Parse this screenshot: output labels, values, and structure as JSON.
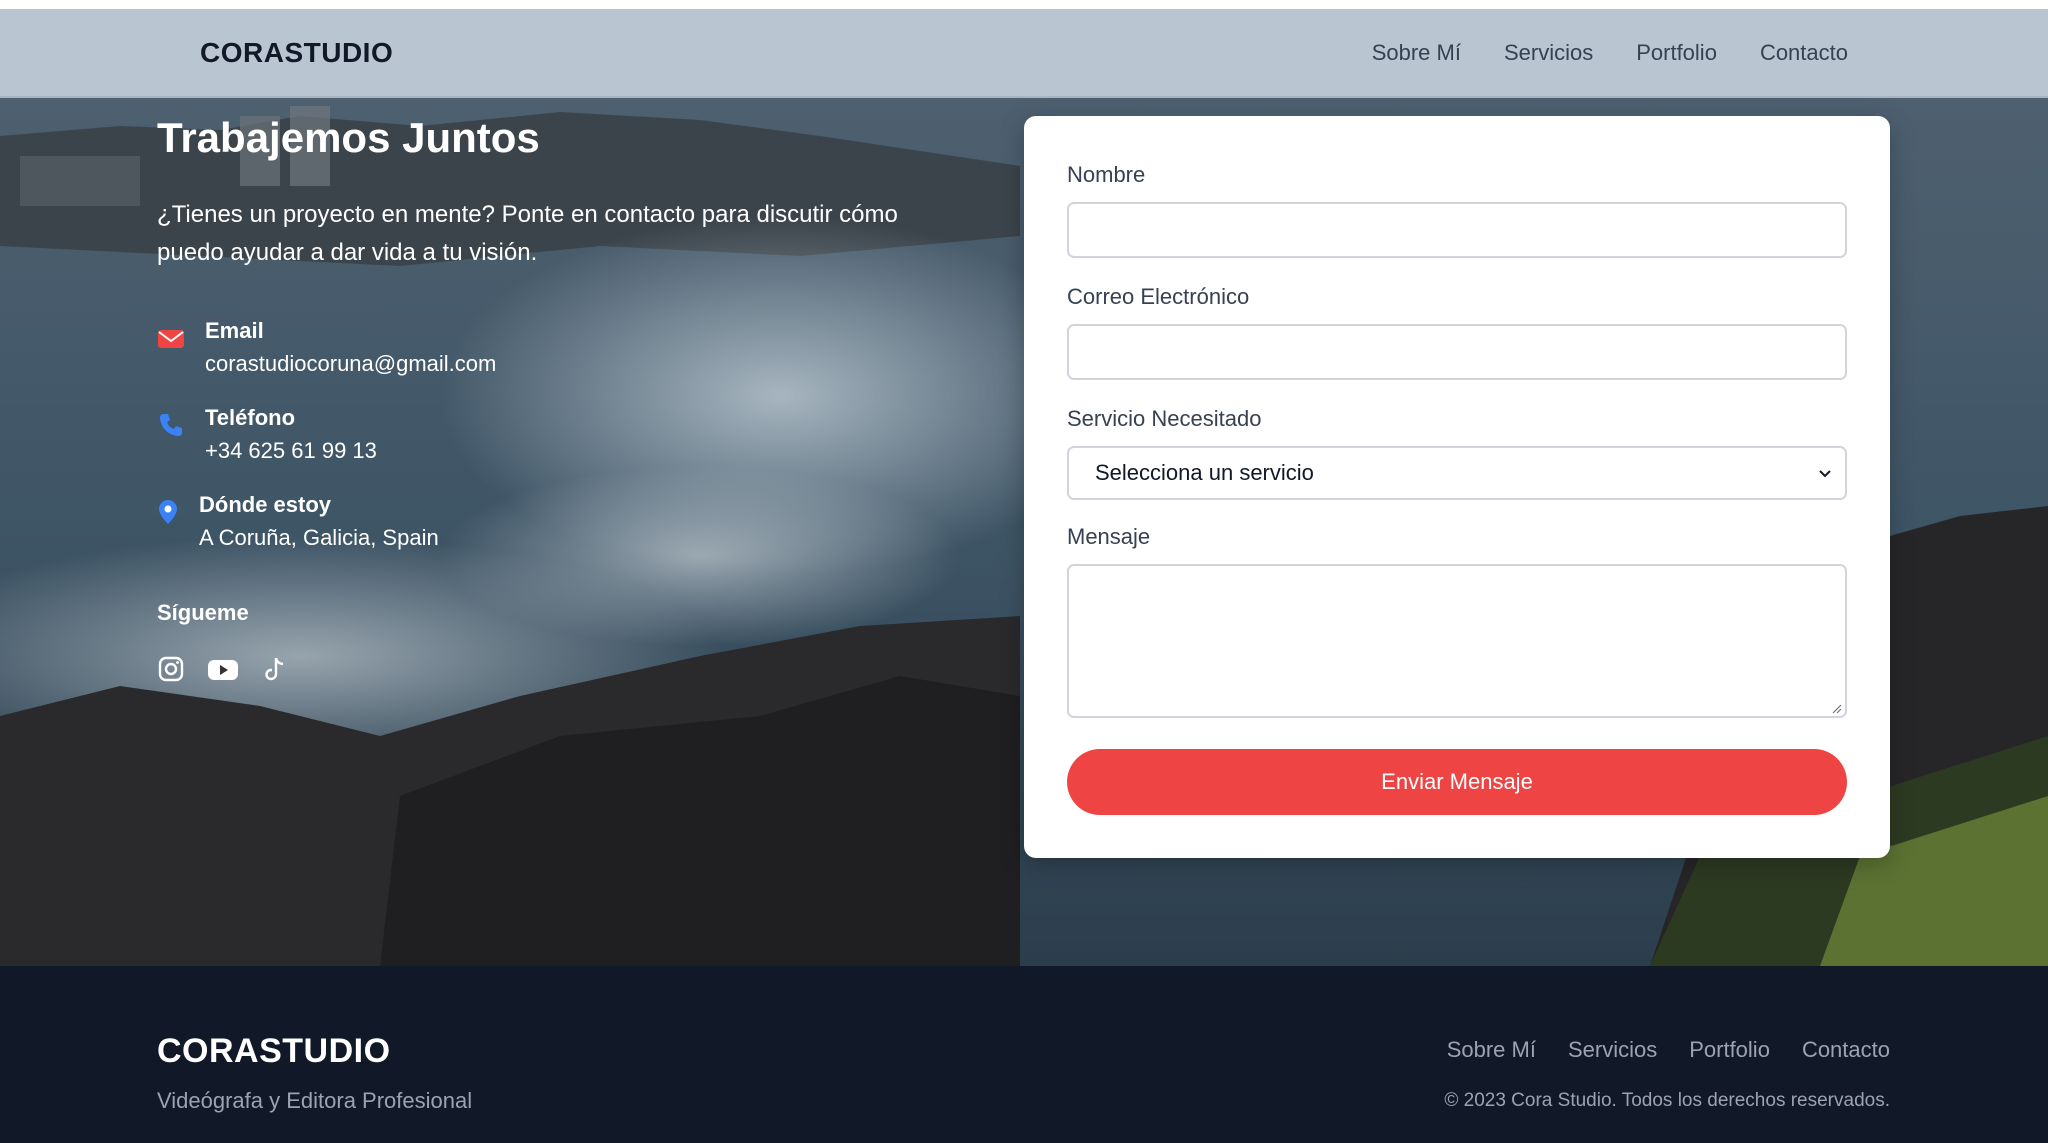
{
  "header": {
    "brand": "CORASTUDIO",
    "nav": [
      "Sobre Mí",
      "Servicios",
      "Portfolio",
      "Contacto"
    ]
  },
  "contact": {
    "title": "Trabajemos Juntos",
    "intro": "¿Tienes un proyecto en mente? Ponte en contacto para discutir cómo puedo ayudar a dar vida a tu visión.",
    "email_label": "Email",
    "email_value": "corastudiocoruna@gmail.com",
    "phone_label": "Teléfono",
    "phone_value": "+34 625 61 99 13",
    "location_label": "Dónde estoy",
    "location_value": "A Coruña, Galicia, Spain",
    "follow_title": "Sígueme",
    "socials": [
      "instagram-icon",
      "youtube-icon",
      "tiktok-icon"
    ]
  },
  "form": {
    "name_label": "Nombre",
    "name_value": "",
    "email_label": "Correo Electrónico",
    "email_value": "",
    "service_label": "Servicio Necesitado",
    "service_selected": "Selecciona un servicio",
    "message_label": "Mensaje",
    "message_value": "",
    "submit_label": "Enviar Mensaje"
  },
  "footer": {
    "brand": "CORASTUDIO",
    "tagline": "Videógrafa y Editora Profesional",
    "nav": [
      "Sobre Mí",
      "Servicios",
      "Portfolio",
      "Contacto"
    ],
    "copyright": "© 2023 Cora Studio. Todos los derechos reservados."
  },
  "colors": {
    "accent": "#ef4444",
    "navbar": "#b9c5d0",
    "footer": "#111827",
    "phone_icon": "#3b82f6",
    "location_icon": "#3b82f6"
  }
}
